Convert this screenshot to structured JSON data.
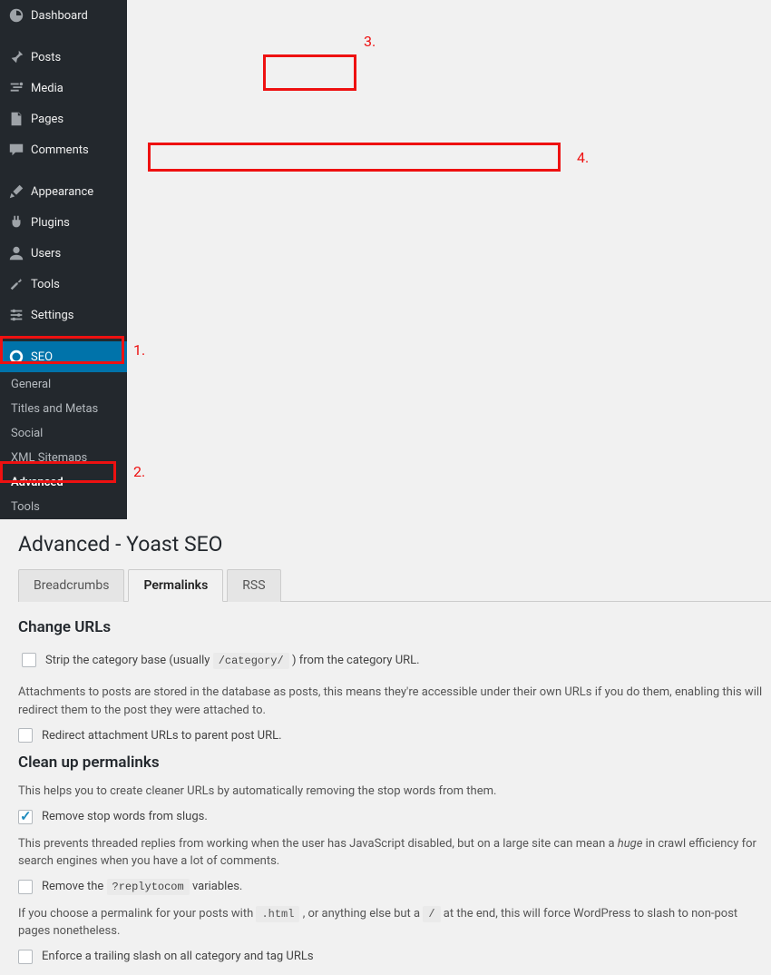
{
  "sidebar": {
    "items": [
      {
        "label": "Dashboard",
        "icon": "dashboard"
      },
      {
        "label": "Posts",
        "icon": "pin"
      },
      {
        "label": "Media",
        "icon": "media"
      },
      {
        "label": "Pages",
        "icon": "page"
      },
      {
        "label": "Comments",
        "icon": "comment"
      },
      {
        "label": "Appearance",
        "icon": "brush"
      },
      {
        "label": "Plugins",
        "icon": "plug"
      },
      {
        "label": "Users",
        "icon": "user"
      },
      {
        "label": "Tools",
        "icon": "wrench"
      },
      {
        "label": "Settings",
        "icon": "sliders"
      },
      {
        "label": "SEO",
        "icon": "seo"
      }
    ],
    "sub": [
      "General",
      "Titles and Metas",
      "Social",
      "XML Sitemaps",
      "Advanced",
      "Tools"
    ]
  },
  "page": {
    "title": "Advanced - Yoast SEO"
  },
  "tabs": {
    "breadcrumbs": "Breadcrumbs",
    "permalinks": "Permalinks",
    "rss": "RSS"
  },
  "sections": {
    "change_urls": "Change URLs",
    "clean_up": "Clean up permalinks"
  },
  "options": {
    "strip_cat_prefix": "Strip the category base (usually ",
    "strip_cat_code": "/category/",
    "strip_cat_suffix": " ) from the category URL.",
    "attach_desc": "Attachments to posts are stored in the database as posts, this means they're accessible under their own URLs if you do them, enabling this will redirect them to the post they were attached to.",
    "redirect_attach": "Redirect attachment URLs to parent post URL.",
    "cleanup_desc": "This helps you to create cleaner URLs by automatically removing the stop words from them.",
    "remove_stopwords": "Remove stop words from slugs.",
    "threaded_prefix": "This prevents threaded replies from working when the user has JavaScript disabled, but on a large site can mean a ",
    "threaded_em": "huge",
    "threaded_suffix": " in crawl efficiency for search engines when you have a lot of comments.",
    "remove_reply_prefix": "Remove the ",
    "remove_reply_code": "?replytocom",
    "remove_reply_suffix": " variables.",
    "slash_prefix": "If you choose a permalink for your posts with ",
    "slash_code1": ".html",
    "slash_mid": " , or anything else but a ",
    "slash_code2": "/",
    "slash_suffix": " at the end, this will force WordPress to slash to non-post pages nonetheless.",
    "enforce_slash": "Enforce a trailing slash on all category and tag URLs"
  },
  "annotations": {
    "l1": "1.",
    "l2": "2.",
    "l3": "3.",
    "l4": "4."
  }
}
